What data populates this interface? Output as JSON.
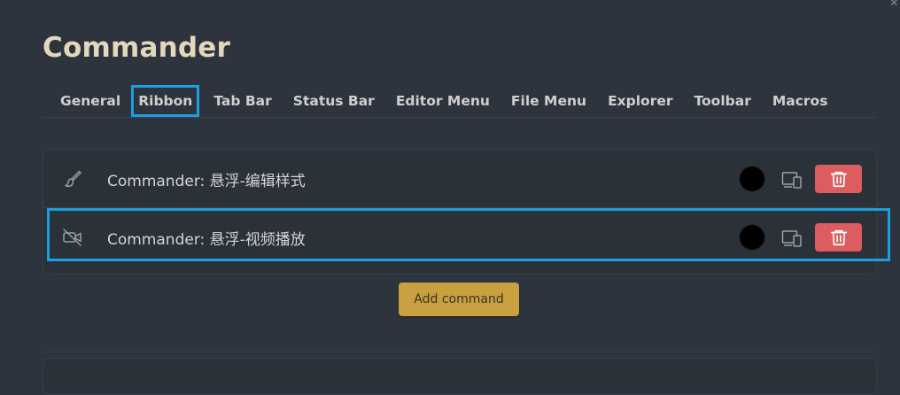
{
  "window": {
    "close_glyph": "×"
  },
  "settings": {
    "title": "Commander",
    "tabs": [
      {
        "label": "General"
      },
      {
        "label": "Ribbon"
      },
      {
        "label": "Tab Bar"
      },
      {
        "label": "Status Bar"
      },
      {
        "label": "Editor Menu"
      },
      {
        "label": "File Menu"
      },
      {
        "label": "Explorer"
      },
      {
        "label": "Toolbar"
      },
      {
        "label": "Macros"
      }
    ],
    "active_tab": "Ribbon"
  },
  "commands": [
    {
      "icon": "paintbrush-icon",
      "label": "Commander: 悬浮-编辑样式",
      "color": "#000000"
    },
    {
      "icon": "video-off-icon",
      "label": "Commander: 悬浮-视频播放",
      "color": "#000000"
    }
  ],
  "actions": {
    "add_command_label": "Add command"
  },
  "colors": {
    "background": "#2e343d",
    "title": "#e3d8bd",
    "highlight": "#1a9fe0",
    "delete": "#dd5c5f",
    "accent": "#c8a040"
  }
}
